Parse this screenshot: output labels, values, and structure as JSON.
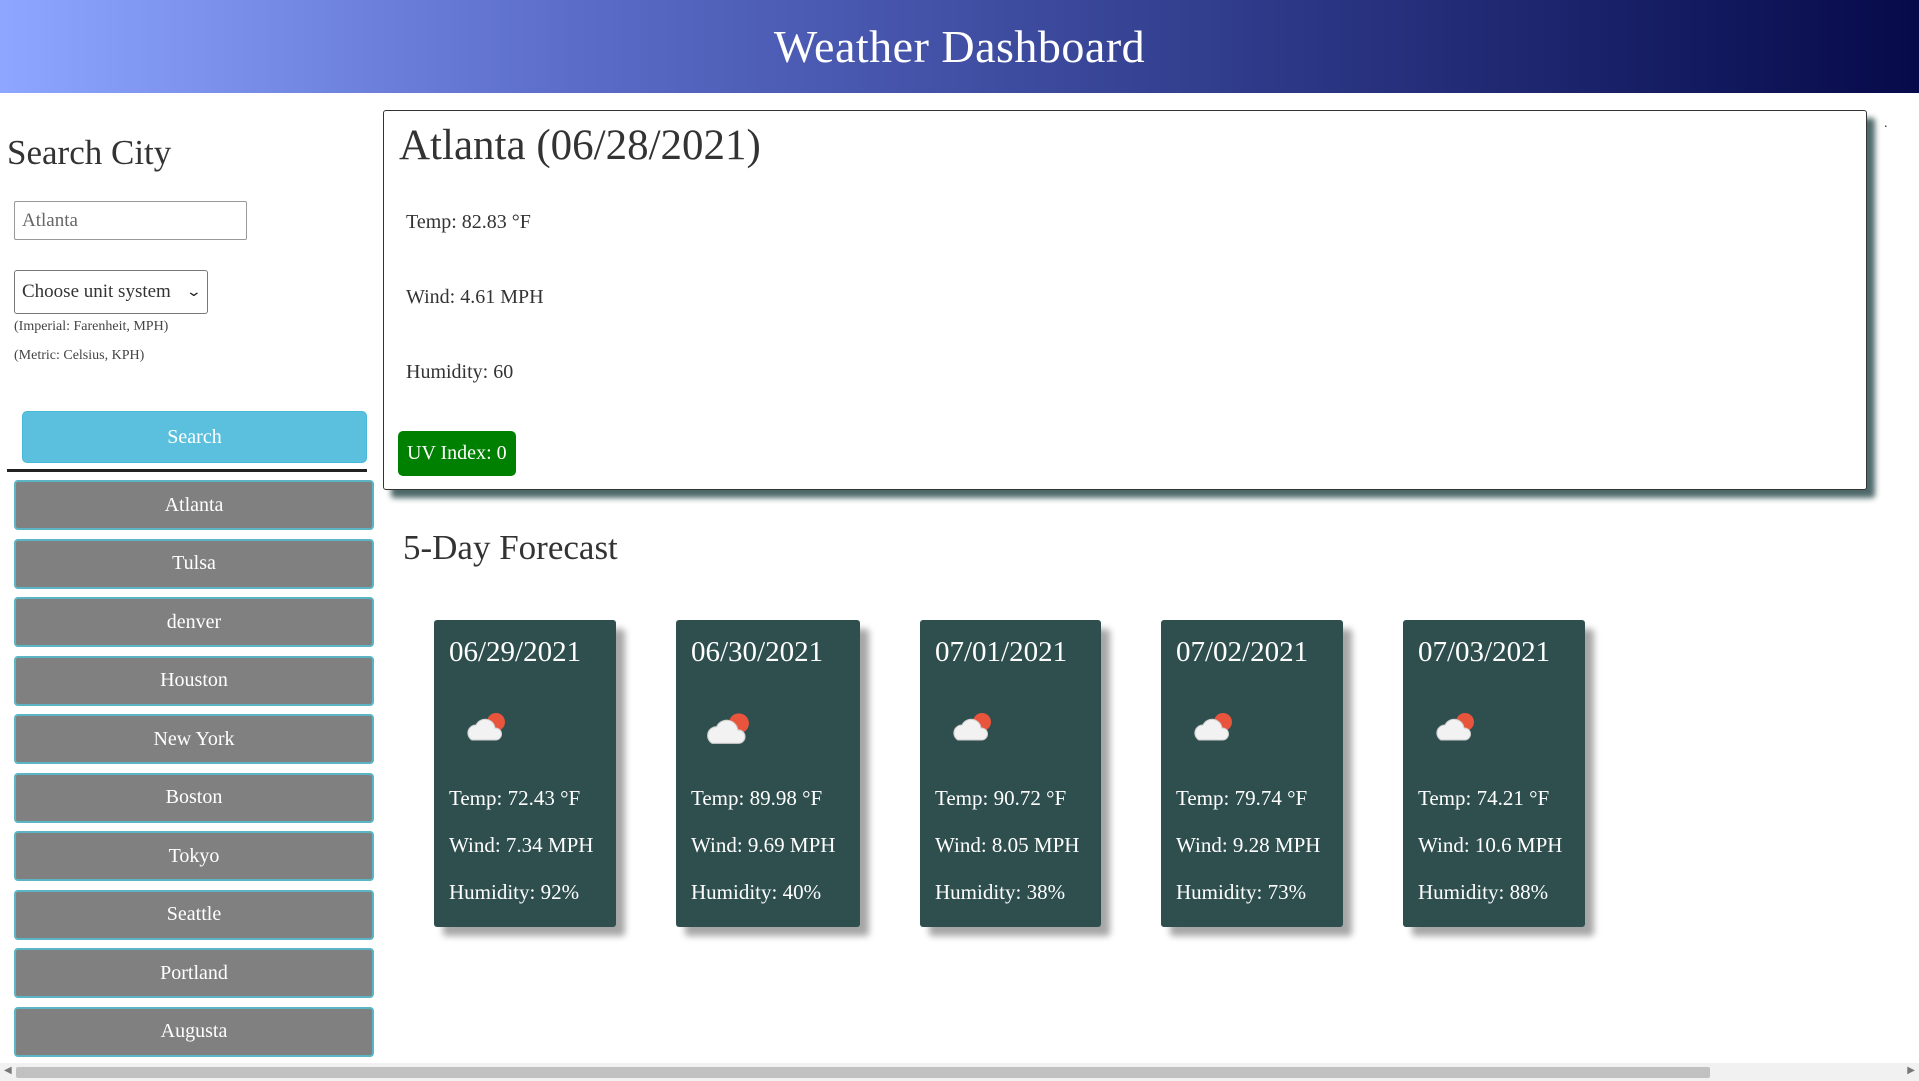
{
  "header": {
    "title": "Weather Dashboard"
  },
  "sidebar": {
    "title": "Search City",
    "search_input": {
      "value": "Atlanta"
    },
    "unit_select": {
      "selected": "Choose unit system"
    },
    "hints": [
      "(Imperial: Farenheit, MPH)",
      "(Metric: Celsius, KPH)"
    ],
    "search_label": "Search",
    "history": [
      "Atlanta",
      "Tulsa",
      "denver",
      "Houston",
      "New York",
      "Boston",
      "Tokyo",
      "Seattle",
      "Portland",
      "Augusta"
    ]
  },
  "current": {
    "title": "Atlanta (06/28/2021)",
    "temp": "Temp: 82.83 °F",
    "wind": "Wind: 4.61 MPH",
    "humidity": "Humidity: 60",
    "uv": "UV Index: 0",
    "uv_color": "#008000"
  },
  "forecast": {
    "title": "5-Day Forecast",
    "days": [
      {
        "date": "06/29/2021",
        "icon": "partly-cloudy-icon",
        "temp": "Temp: 72.43 °F",
        "wind": "Wind: 7.34 MPH",
        "humidity": "Humidity: 92%"
      },
      {
        "date": "06/30/2021",
        "icon": "partly-cloudy-icon",
        "temp": "Temp: 89.98 °F",
        "wind": "Wind: 9.69 MPH",
        "humidity": "Humidity: 40%"
      },
      {
        "date": "07/01/2021",
        "icon": "partly-cloudy-icon",
        "temp": "Temp: 90.72 °F",
        "wind": "Wind: 8.05 MPH",
        "humidity": "Humidity: 38%"
      },
      {
        "date": "07/02/2021",
        "icon": "partly-cloudy-icon",
        "temp": "Temp: 79.74 °F",
        "wind": "Wind: 9.28 MPH",
        "humidity": "Humidity: 73%"
      },
      {
        "date": "07/03/2021",
        "icon": "partly-cloudy-icon",
        "temp": "Temp: 74.21 °F",
        "wind": "Wind: 10.6 MPH",
        "humidity": "Humidity: 88%"
      }
    ]
  },
  "colors": {
    "accent": "#5bc0de",
    "card_bg": "#2f4f4f",
    "history_bg": "#808080"
  }
}
